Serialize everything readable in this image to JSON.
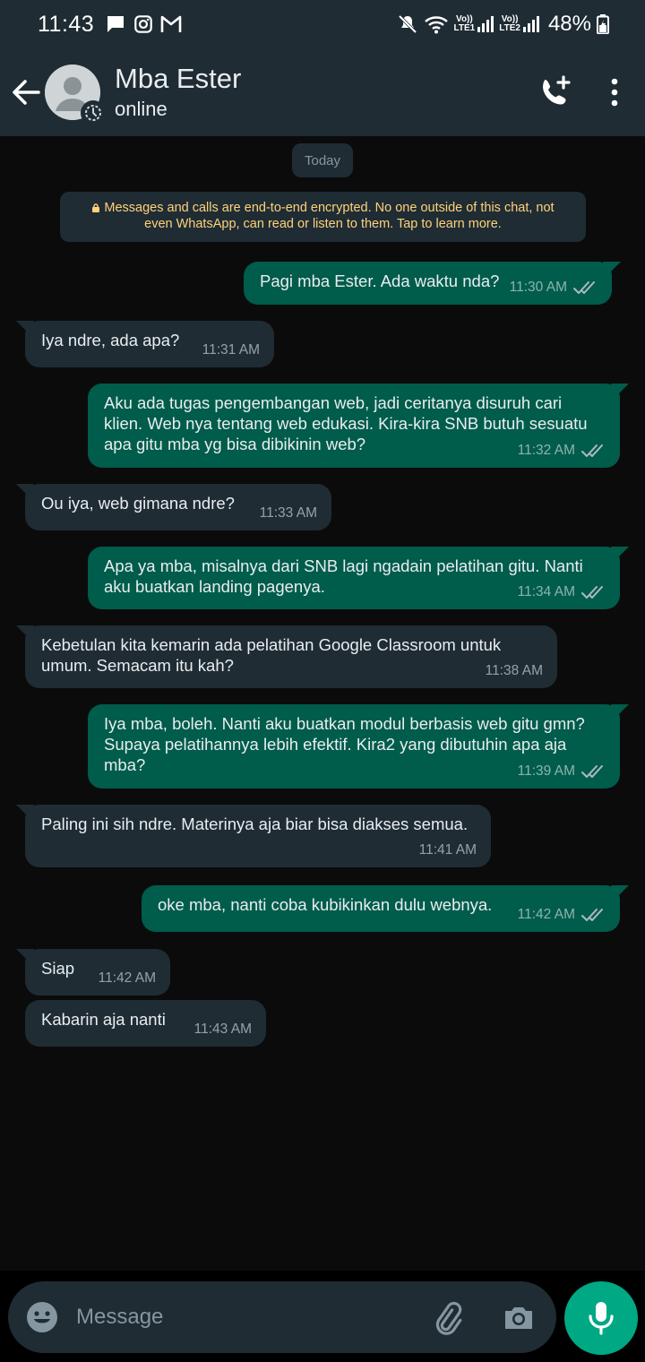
{
  "status_bar": {
    "time": "11:43",
    "left_icons": [
      "chat-bubble-icon",
      "instagram-icon",
      "gmail-icon"
    ],
    "right_icons": [
      "mute-icon",
      "wifi-icon",
      "signal-lte1-icon",
      "signal-lte2-icon",
      "battery-icon"
    ],
    "lte1_top": "Vo))",
    "lte1_bottom": "LTE1",
    "lte2_top": "Vo))",
    "lte2_bottom": "LTE2",
    "battery": "48%"
  },
  "header": {
    "contact_name": "Mba Ester",
    "contact_status": "online",
    "icons": [
      "back-arrow-icon",
      "avatar",
      "add-call-icon",
      "more-vert-icon"
    ],
    "color": "#1f2c34"
  },
  "chat": {
    "date_chip": "Today",
    "encryption_notice": "Messages and calls are end-to-end encrypted. No one outside of this chat, not even WhatsApp, can read or listen to them. Tap to learn more.",
    "colors": {
      "incoming": "#1f2c34",
      "outgoing": "#005c4b",
      "background": "#0b0b0b"
    },
    "messages": [
      {
        "dir": "out",
        "text": "Pagi mba Ester. Ada waktu nda?",
        "time": "11:30 AM"
      },
      {
        "dir": "in",
        "text": "Iya ndre, ada apa?",
        "time": "11:31 AM"
      },
      {
        "dir": "out",
        "text": "Aku ada tugas pengembangan web, jadi ceritanya disuruh cari klien. Web nya tentang web edukasi. Kira-kira SNB butuh sesuatu apa gitu mba yg bisa dibikinin web?",
        "time": "11:32 AM"
      },
      {
        "dir": "in",
        "text": "Ou iya, web gimana ndre?",
        "time": "11:33 AM"
      },
      {
        "dir": "out",
        "text": "Apa ya mba, misalnya dari SNB lagi ngadain pelatihan gitu. Nanti aku buatkan landing pagenya.",
        "time": "11:34 AM"
      },
      {
        "dir": "in",
        "text": "Kebetulan kita kemarin ada pelatihan Google Classroom untuk umum. Semacam itu kah?",
        "time": "11:38 AM"
      },
      {
        "dir": "out",
        "text": "Iya mba, boleh. Nanti aku buatkan modul berbasis web gitu gmn? Supaya pelatihannya lebih efektif. Kira2 yang dibutuhin apa aja mba?",
        "time": "11:39 AM"
      },
      {
        "dir": "in",
        "text": "Paling ini sih ndre. Materinya aja biar bisa diakses semua.",
        "time": "11:41 AM"
      },
      {
        "dir": "out",
        "text": "oke mba, nanti coba kubikinkan dulu webnya.",
        "time": "11:42 AM"
      },
      {
        "dir": "in",
        "text": "Siap",
        "time": "11:42 AM"
      },
      {
        "dir": "in",
        "text": "Kabarin aja nanti",
        "time": "11:43 AM"
      }
    ]
  },
  "input_bar": {
    "placeholder": "Message",
    "icons": [
      "emoji-icon",
      "attach-icon",
      "camera-icon",
      "mic-icon"
    ],
    "mic_color": "#00a884"
  }
}
